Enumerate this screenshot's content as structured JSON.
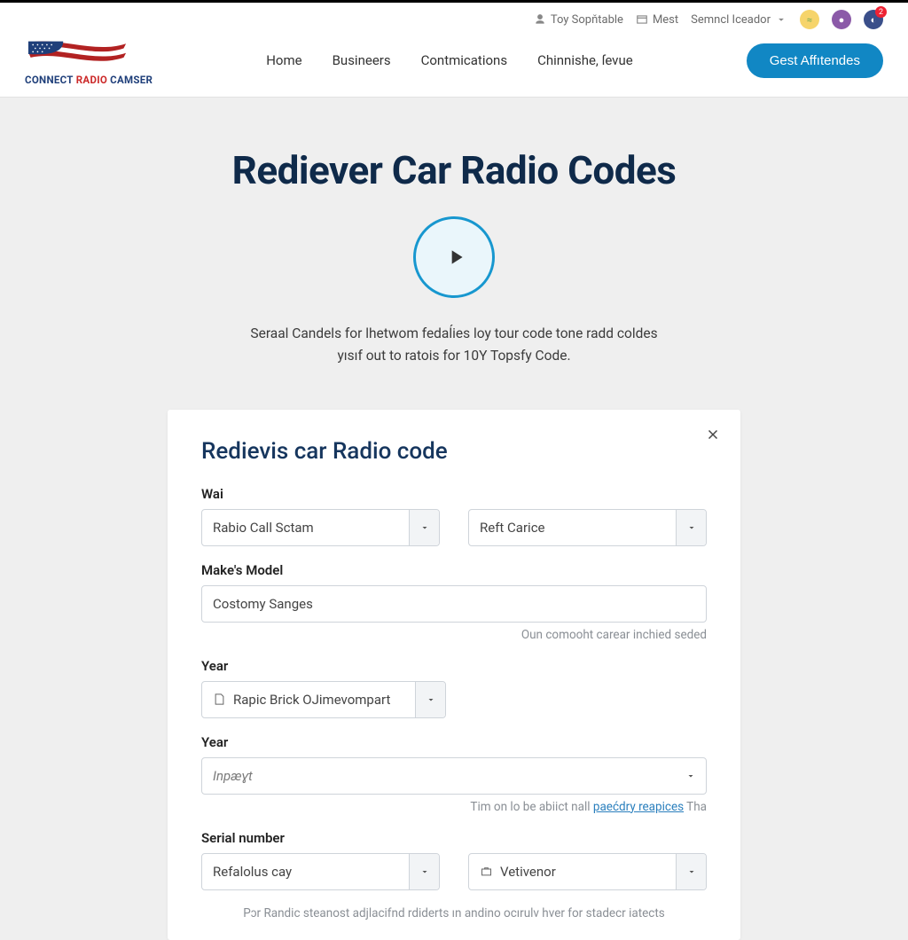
{
  "topbar": {
    "util": {
      "user": "Toy Sopňtable",
      "mest": "Mest",
      "search": "Semncl Iceador"
    },
    "badge_count": "2",
    "logo": {
      "a": "CONNECT",
      "b": "RADIO",
      "c": "CAMSER"
    },
    "nav": {
      "home": "Home",
      "business": "Busineers",
      "comms": "Contmications",
      "chin": "Chinnishe, ſevue"
    },
    "cta": "Gest Affıtendes"
  },
  "hero": {
    "title": "Rediever Car Radio Codes",
    "line1": "Seraal Candels for lhetwom fedaĺies loy tour code tone radd coldes",
    "line2": "yısıf out to ratois for 10Y Topsfy Code."
  },
  "card": {
    "title": "Redievis car Radio code",
    "wai_label": "Wai",
    "wai_value": "Rabio Call Sctam",
    "reft_value": "Reft Carice",
    "make_label": "Make's Model",
    "make_value": "Costomy Sanges",
    "make_helper": "Oun comooht carear inchied seded",
    "year1_label": "Year",
    "year1_value": "Rapic Brick OJimevompart",
    "year2_label": "Year",
    "year2_placeholder": "Inpæɣt",
    "year2_helper_pre": "Tim on lo be abiict nall ",
    "year2_helper_link": "paećdry reapices",
    "year2_helper_post": " Tha",
    "serial_label": "Serial number",
    "serial_value": "Refalolus cay",
    "vet_value": "Vetivenor",
    "footer": "Pɔr Randic steanost adjlacifnd rdiderts ın andino ocırulv hver for stadecr iatects"
  }
}
